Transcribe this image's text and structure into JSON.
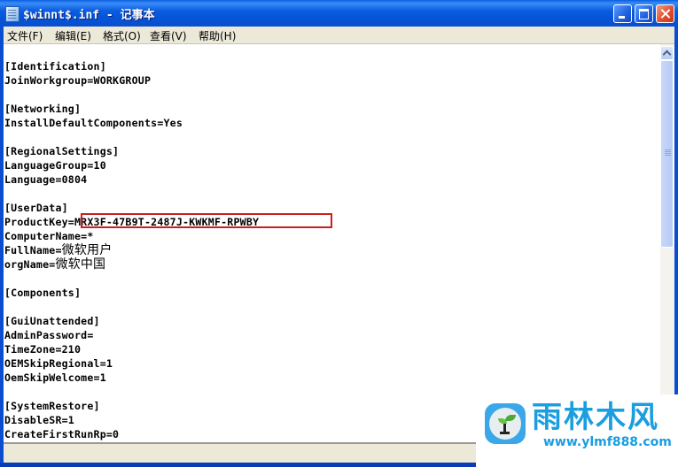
{
  "window": {
    "title": "$winnt$.inf - 记事本",
    "controls": {
      "minimize": "minimize",
      "maximize": "maximize",
      "close": "close"
    }
  },
  "menu": [
    {
      "label": "文件(F)"
    },
    {
      "label": "编辑(E)"
    },
    {
      "label": "格式(O)"
    },
    {
      "label": "查看(V)"
    },
    {
      "label": "帮助(H)"
    }
  ],
  "document": {
    "lines": [
      "[Identification]",
      "JoinWorkgroup=WORKGROUP",
      "",
      "[Networking]",
      "InstallDefaultComponents=Yes",
      "",
      "[RegionalSettings]",
      "LanguageGroup=10",
      "Language=0804",
      "",
      "[UserData]",
      "ProductKey=MRX3F-47B9T-2487J-KWKMF-RPWBY",
      "ComputerName=*",
      "FullName=微软用户",
      "orgName=微软中国",
      "",
      "[Components]",
      "",
      "[GuiUnattended]",
      "AdminPassword=",
      "TimeZone=210",
      "OEMSkipRegional=1",
      "OemSkipWelcome=1",
      "",
      "[SystemRestore]",
      "DisableSR=1",
      "CreateFirstRunRp=0"
    ],
    "highlighted_product_key": "MRX3F-47B9T-2487J-KWKMF-RPWBY",
    "highlight_color": "#c82020"
  },
  "watermark": {
    "title": "雨林木风",
    "url": "www.ylmf888.com",
    "color": "#1a9ee0"
  }
}
